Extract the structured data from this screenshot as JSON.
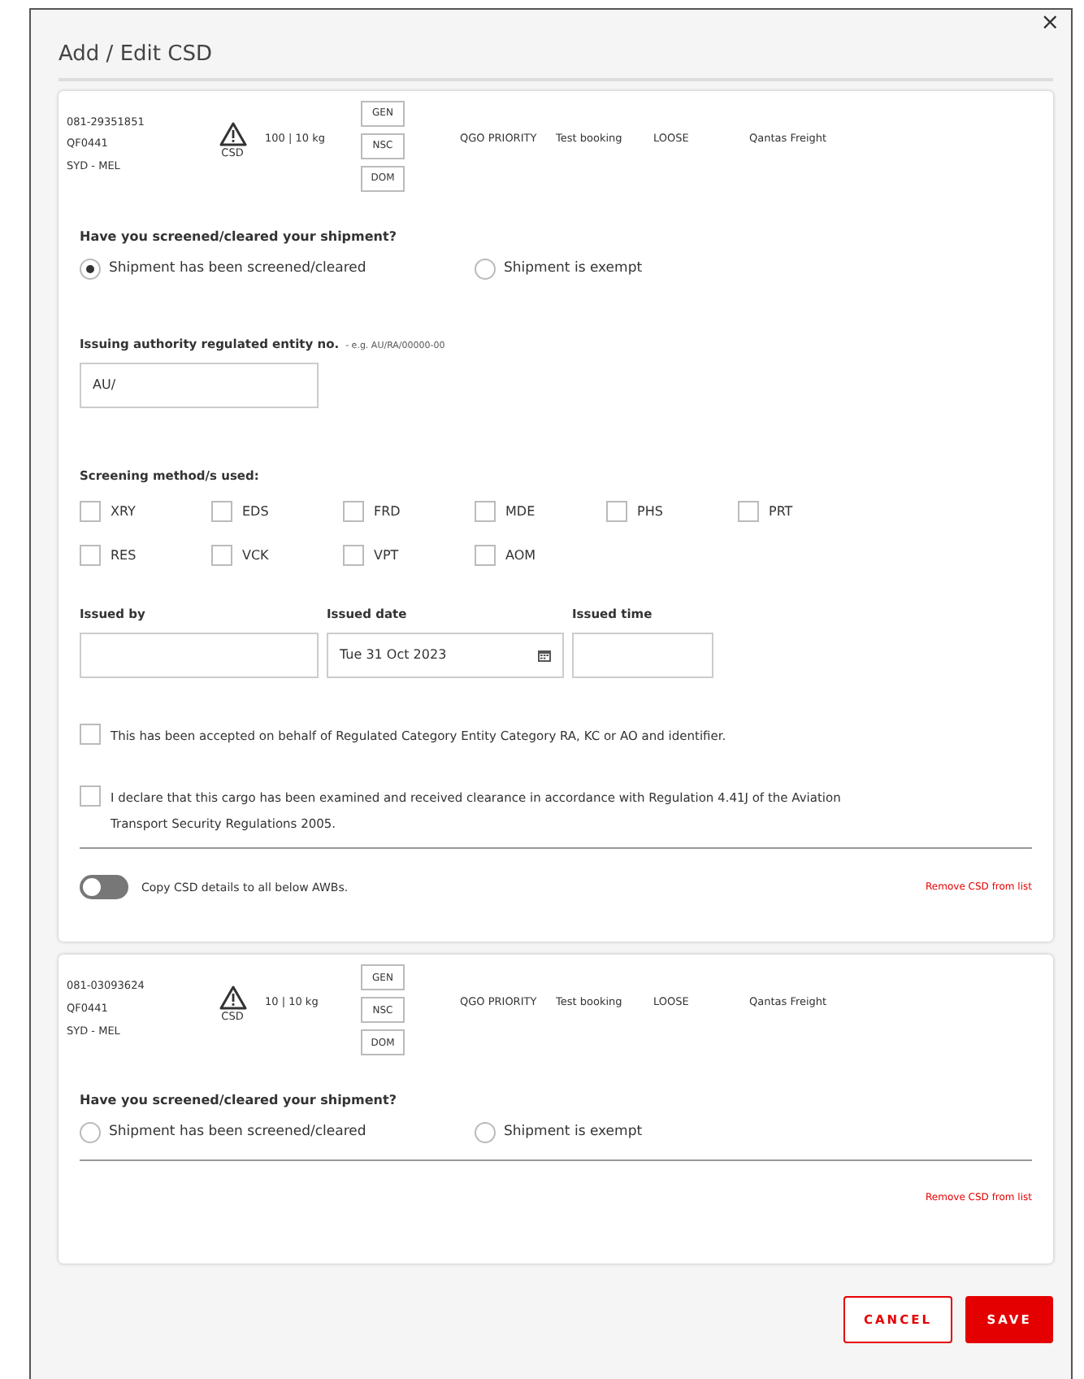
{
  "dialog": {
    "title": "Add / Edit CSD",
    "close": "×"
  },
  "shipments": [
    {
      "awb": "081-29351851",
      "flight": "QF0441",
      "route": "SYD - MEL",
      "warning_label": "CSD",
      "pieces_weight": "100 | 10 kg",
      "tags": [
        "GEN",
        "NSC",
        "DOM"
      ],
      "service": "QGO PRIORITY",
      "booking": "Test booking",
      "packing": "LOOSE",
      "carrier": "Qantas Freight",
      "question": "Have you screened/cleared your shipment?",
      "options": [
        {
          "label": "Shipment has been screened/cleared",
          "selected": true
        },
        {
          "label": "Shipment is exempt",
          "selected": false
        }
      ],
      "form": {
        "issuing_label": "Issuing authority regulated entity no.",
        "issuing_hint": "- e.g. AU/RA/00000-00",
        "issuing_value": "AU/",
        "methods_label": "Screening method/s used:",
        "methods": [
          {
            "label": "XRY",
            "checked": false
          },
          {
            "label": "EDS",
            "checked": false
          },
          {
            "label": "FRD",
            "checked": false
          },
          {
            "label": "MDE",
            "checked": false
          },
          {
            "label": "PHS",
            "checked": false
          },
          {
            "label": "PRT",
            "checked": false
          },
          {
            "label": "RES",
            "checked": false
          },
          {
            "label": "VCK",
            "checked": false
          },
          {
            "label": "VPT",
            "checked": false
          },
          {
            "label": "AOM",
            "checked": false
          }
        ],
        "issued": [
          {
            "label": "Issued by",
            "kind": "text"
          },
          {
            "label": "Issued date",
            "value": "Tue 31 Oct 2023",
            "kind": "date"
          },
          {
            "label": "Issued time",
            "kind": "text"
          }
        ],
        "declarations": [
          {
            "text": "This has been accepted on behalf of Regulated Category Entity Category RA, KC or AO and identifier.",
            "checked": false
          },
          {
            "text": "I declare that this cargo has been examined and received clearance in accordance with Regulation 4.41J of the Aviation Transport Security Regulations 2005.",
            "checked": false
          }
        ],
        "copy_toggle": {
          "label": "Copy CSD details to all below AWBs.",
          "on": false
        }
      },
      "remove_link": "Remove CSD from list"
    },
    {
      "awb": "081-03093624",
      "flight": "QF0441",
      "route": "SYD - MEL",
      "warning_label": "CSD",
      "pieces_weight": "10 | 10 kg",
      "tags": [
        "GEN",
        "NSC",
        "DOM"
      ],
      "service": "QGO PRIORITY",
      "booking": "Test booking",
      "packing": "LOOSE",
      "carrier": "Qantas Freight",
      "question": "Have you screened/cleared your shipment?",
      "options": [
        {
          "label": "Shipment has been screened/cleared",
          "selected": false
        },
        {
          "label": "Shipment is exempt",
          "selected": false
        }
      ],
      "remove_link": "Remove CSD from list"
    }
  ],
  "buttons": [
    {
      "label": "CANCEL",
      "kind": "outline"
    },
    {
      "label": "SAVE",
      "kind": "primary"
    }
  ]
}
